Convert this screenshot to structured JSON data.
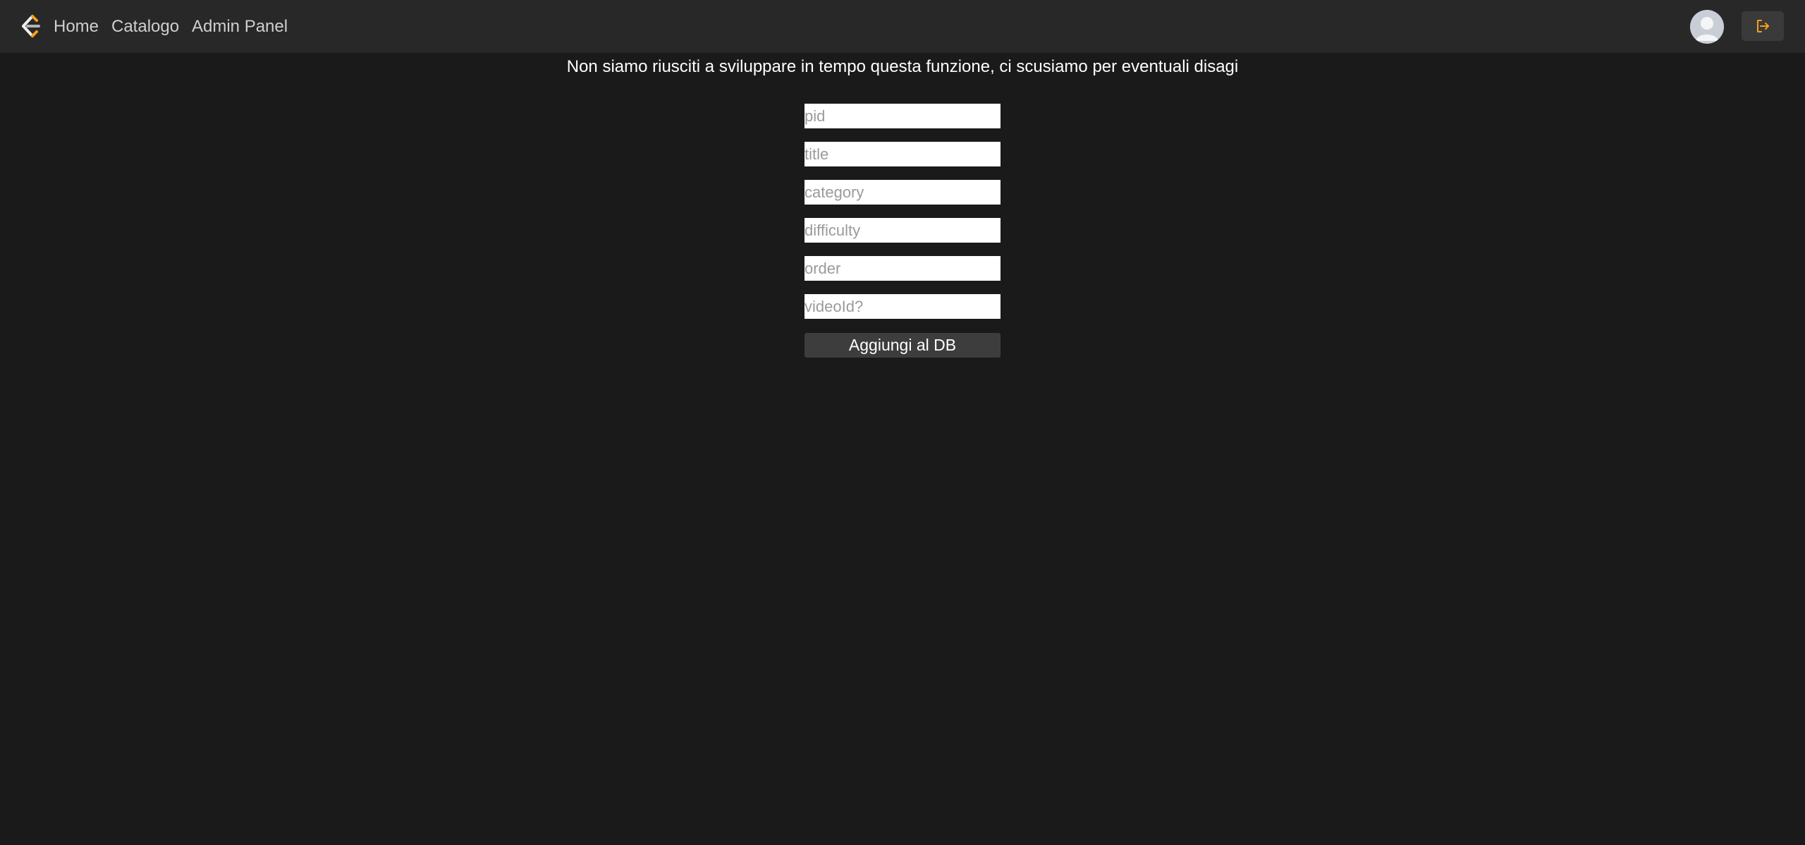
{
  "nav": {
    "logo_icon": "leetcode-style-logo-icon",
    "links": [
      "Home",
      "Catalogo",
      "Admin Panel"
    ]
  },
  "user": {
    "avatar_icon": "user-avatar-icon",
    "logout_icon": "logout-icon"
  },
  "main": {
    "notice": "Non siamo riusciti a sviluppare in tempo questa funzione, ci scusiamo per eventuali disagi",
    "fields": {
      "pid": {
        "placeholder": "pid",
        "value": ""
      },
      "title": {
        "placeholder": "title",
        "value": ""
      },
      "category": {
        "placeholder": "category",
        "value": ""
      },
      "difficulty": {
        "placeholder": "difficulty",
        "value": ""
      },
      "order": {
        "placeholder": "order",
        "value": ""
      },
      "videoid": {
        "placeholder": "videoId?",
        "value": ""
      }
    },
    "submit_label": "Aggiungi al DB"
  },
  "colors": {
    "background": "#1a1a1a",
    "topbar": "#282828",
    "accent": "#f89f1b",
    "button": "#3d3d3d"
  }
}
